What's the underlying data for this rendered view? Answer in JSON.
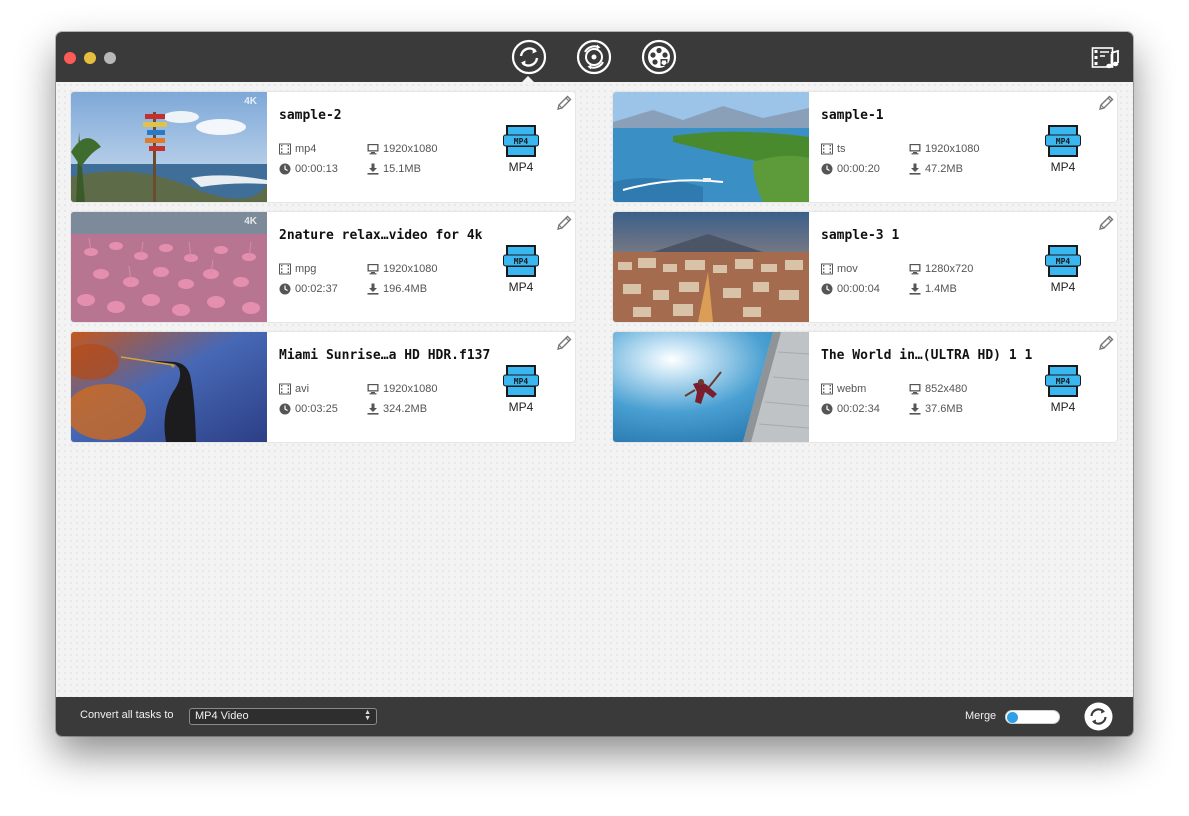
{
  "toolbar": {
    "tabs": [
      {
        "name": "convert-tab",
        "icon": "convert-icon",
        "active": true
      },
      {
        "name": "dvd-ripper-tab",
        "icon": "dvd-rip-icon",
        "active": false
      },
      {
        "name": "video-download-tab",
        "icon": "film-reel-download-icon",
        "active": false
      }
    ],
    "right_icon": "media-library-icon"
  },
  "videos": [
    {
      "title": "sample-2",
      "container": "mp4",
      "resolution": "1920x1080",
      "duration": "00:00:13",
      "size": "15.1MB",
      "output": "MP4",
      "badge": "4K"
    },
    {
      "title": "sample-1",
      "container": "ts",
      "resolution": "1920x1080",
      "duration": "00:00:20",
      "size": "47.2MB",
      "output": "MP4",
      "badge": ""
    },
    {
      "title": "2nature relax…video for 4k",
      "container": "mpg",
      "resolution": "1920x1080",
      "duration": "00:02:37",
      "size": "196.4MB",
      "output": "MP4",
      "badge": "4K"
    },
    {
      "title": "sample-3 1",
      "container": "mov",
      "resolution": "1280x720",
      "duration": "00:00:04",
      "size": "1.4MB",
      "output": "MP4",
      "badge": ""
    },
    {
      "title": "Miami Sunrise…a HD HDR.f137",
      "container": "avi",
      "resolution": "1920x1080",
      "duration": "00:03:25",
      "size": "324.2MB",
      "output": "MP4",
      "badge": ""
    },
    {
      "title": "The World in…(ULTRA HD) 1 1",
      "container": "webm",
      "resolution": "852x480",
      "duration": "00:02:34",
      "size": "37.6MB",
      "output": "MP4",
      "badge": ""
    }
  ],
  "format_badge_text": "MP4",
  "bottom": {
    "convert_label": "Convert all tasks to",
    "convert_value": "MP4 Video",
    "merge_label": "Merge",
    "merge_on": false
  },
  "colors": {
    "titlebar": "#3a3a3a",
    "accent": "#2f9fe8"
  }
}
